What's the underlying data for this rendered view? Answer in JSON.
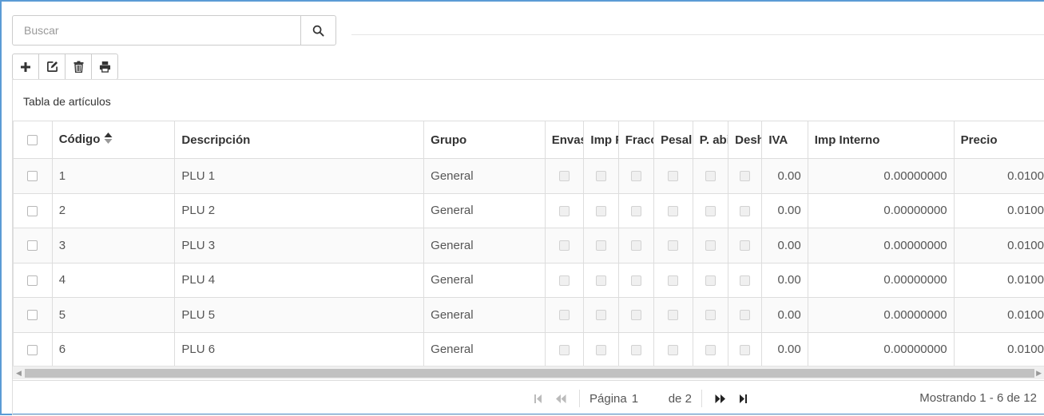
{
  "search": {
    "placeholder": "Buscar",
    "value": "",
    "icon": "search-icon"
  },
  "toolbar": {
    "buttons": [
      {
        "icon": "plus-icon"
      },
      {
        "icon": "edit-icon"
      },
      {
        "icon": "trash-icon"
      },
      {
        "icon": "print-icon"
      }
    ]
  },
  "panel": {
    "title": "Tabla de artículos"
  },
  "table": {
    "columns": [
      "Código",
      "Descripción",
      "Grupo",
      "Envas",
      "Imp F",
      "Fracc",
      "Pesal",
      "P. abi",
      "Desh",
      "IVA",
      "Imp Interno",
      "Precio"
    ],
    "sort_column": "Código",
    "rows": [
      {
        "codigo": "1",
        "descripcion": "PLU 1",
        "grupo": "General",
        "iva": "0.00",
        "imp_interno": "0.00000000",
        "precio": "0.0100"
      },
      {
        "codigo": "2",
        "descripcion": "PLU 2",
        "grupo": "General",
        "iva": "0.00",
        "imp_interno": "0.00000000",
        "precio": "0.0100"
      },
      {
        "codigo": "3",
        "descripcion": "PLU 3",
        "grupo": "General",
        "iva": "0.00",
        "imp_interno": "0.00000000",
        "precio": "0.0100"
      },
      {
        "codigo": "4",
        "descripcion": "PLU 4",
        "grupo": "General",
        "iva": "0.00",
        "imp_interno": "0.00000000",
        "precio": "0.0100"
      },
      {
        "codigo": "5",
        "descripcion": "PLU 5",
        "grupo": "General",
        "iva": "0.00",
        "imp_interno": "0.00000000",
        "precio": "0.0100"
      },
      {
        "codigo": "6",
        "descripcion": "PLU 6",
        "grupo": "General",
        "iva": "0.00",
        "imp_interno": "0.00000000",
        "precio": "0.0100"
      }
    ]
  },
  "pager": {
    "page_label": "Página",
    "page_value": "1",
    "of_label": "de 2",
    "showing": "Mostrando 1 - 6 de 12"
  },
  "colors": {
    "frame_border": "#5b9bd5",
    "grid_border": "#dddddd"
  }
}
